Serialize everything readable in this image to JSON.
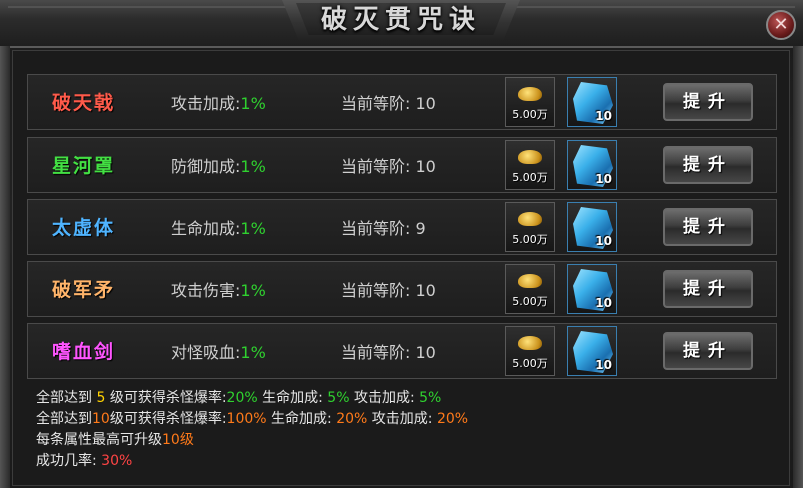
{
  "window": {
    "title": "破灭贯咒诀",
    "close_label": "✕"
  },
  "skills": [
    {
      "name": "破天戟",
      "color": "#ff5a4a",
      "attr_label": "攻击加成:",
      "attr_value": "1%",
      "grade_label": "当前等阶:",
      "grade_value": "10",
      "coin_amount": "5.00万",
      "crystal_count": "10",
      "button": "提升"
    },
    {
      "name": "星河罩",
      "color": "#43e043",
      "attr_label": "防御加成:",
      "attr_value": "1%",
      "grade_label": "当前等阶:",
      "grade_value": "10",
      "coin_amount": "5.00万",
      "crystal_count": "10",
      "button": "提升"
    },
    {
      "name": "太虚体",
      "color": "#4fb4ff",
      "attr_label": "生命加成:",
      "attr_value": "1%",
      "grade_label": "当前等阶:",
      "grade_value": "9",
      "coin_amount": "5.00万",
      "crystal_count": "10",
      "button": "提升"
    },
    {
      "name": "破军矛",
      "color": "#ffb46a",
      "attr_label": "攻击伤害:",
      "attr_value": "1%",
      "grade_label": "当前等阶:",
      "grade_value": "10",
      "coin_amount": "5.00万",
      "crystal_count": "10",
      "button": "提升"
    },
    {
      "name": "嗜血剑",
      "color": "#ff55ff",
      "attr_label": "对怪吸血:",
      "attr_value": "1%",
      "grade_label": "当前等阶:",
      "grade_value": "10",
      "coin_amount": "5.00万",
      "crystal_count": "10",
      "button": "提升"
    }
  ],
  "footer": {
    "line1": {
      "prefix": "全部达到 ",
      "level": "5",
      "mid": " 级可获得杀怪爆率:",
      "drop": "20%",
      "hp_label": " 生命加成: ",
      "hp": "5%",
      "atk_label": "  攻击加成: ",
      "atk": "5%"
    },
    "line2": {
      "prefix": "全部达到",
      "level": "10",
      "mid": "级可获得杀怪爆率:",
      "drop": "100%",
      "hp_label": " 生命加成: ",
      "hp": "20%",
      "atk_label": "  攻击加成: ",
      "atk": "20%"
    },
    "line3": {
      "prefix": "每条属性最高可升级",
      "level": "10级"
    },
    "line4": {
      "prefix": "成功几率: ",
      "rate": "30%"
    }
  }
}
